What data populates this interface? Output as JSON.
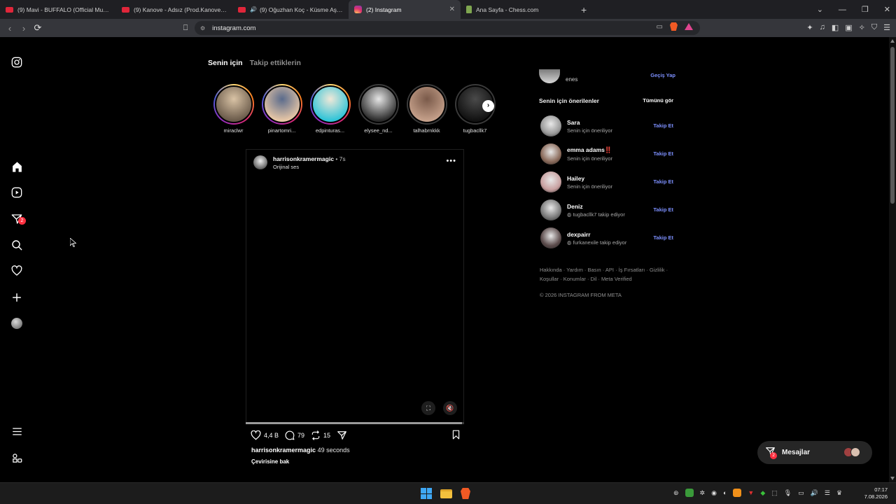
{
  "browser": {
    "tabs": [
      {
        "title": "(9) Mavi - BUFFALO (Official Music V",
        "favicon": "youtube-icon",
        "audio": false,
        "active": false
      },
      {
        "title": "(9) Kanove - Adsız (Prod.Kanove) - Yo",
        "favicon": "youtube-icon",
        "audio": false,
        "active": false
      },
      {
        "title": "(9) Oğuzhan Koç - Küsme Aşka -",
        "favicon": "youtube-icon",
        "audio": true,
        "active": false
      },
      {
        "title": "(2) Instagram",
        "favicon": "instagram-icon",
        "audio": false,
        "active": true
      },
      {
        "title": "Ana Sayfa - Chess.com",
        "favicon": "chess-icon",
        "audio": false,
        "active": false
      }
    ],
    "url": "instagram.com",
    "accent": "#f15a24"
  },
  "leftnav": {
    "items": [
      "instagram-logo",
      "home",
      "reels",
      "messages",
      "search",
      "notifications",
      "create",
      "profile",
      "more",
      "also-from-meta"
    ],
    "messages_badge": "2"
  },
  "feed": {
    "tab_for_you": "Senin için",
    "tab_following": "Takip ettiklerin",
    "stories": [
      {
        "name": "miraclwr",
        "seen": false,
        "colors": [
          "#6a5a4a",
          "#d9c3a5"
        ]
      },
      {
        "name": "pinartomri...",
        "seen": false,
        "colors": [
          "#e8c7a6",
          "#5a6b8c"
        ]
      },
      {
        "name": "edpinturas...",
        "seen": false,
        "colors": [
          "#2fc4d8",
          "#f0e8d8"
        ]
      },
      {
        "name": "elysee_nd...",
        "seen": true,
        "colors": [
          "#2a2a2a",
          "#e6e6e6"
        ]
      },
      {
        "name": "talhabrnkkk",
        "seen": true,
        "colors": [
          "#c5a08a",
          "#7a5a4a"
        ]
      },
      {
        "name": "tugbacllk7",
        "seen": true,
        "colors": [
          "#111",
          "#4a4a4a"
        ]
      }
    ],
    "post": {
      "username": "harrisonkramermagic",
      "time": "7s",
      "audio": "Orijinal ses",
      "likes": "4,4 B",
      "comments": "79",
      "reposts": "15",
      "caption_user": "harrisonkramermagic",
      "caption_text": "49 seconds",
      "translate": "Çevirisine bak",
      "progress": 0.99
    }
  },
  "sidebar": {
    "me_name": "enes",
    "switch": "Geçiş Yap",
    "suggestions_title": "Senin için önerilenler",
    "see_all": "Tümünü gör",
    "suggestions": [
      {
        "name": "Sara",
        "sub": "Senin için öneriliyor",
        "follow": "Takip Et",
        "has_mutual_icon": false,
        "color": "#9a9a9a"
      },
      {
        "name": "emma adams‼️",
        "sub": "Senin için öneriliyor",
        "follow": "Takip Et",
        "has_mutual_icon": false,
        "color": "#8a6a5a"
      },
      {
        "name": "Hailey",
        "sub": "Senin için öneriliyor",
        "follow": "Takip Et",
        "has_mutual_icon": false,
        "color": "#c8a0a0"
      },
      {
        "name": "Deniz",
        "sub": "tugbacllk7 takip ediyor",
        "follow": "Takip Et",
        "has_mutual_icon": true,
        "color": "#7a7a7a"
      },
      {
        "name": "dexpairr",
        "sub": "furkanexile takip ediyor",
        "follow": "Takip Et",
        "has_mutual_icon": true,
        "color": "#5a4a4a"
      }
    ],
    "footer_links": "Hakkında · Yardım · Basın · API · İş Fırsatları · Gizlilik · Koşullar · Konumlar · Dil · Meta Verified",
    "copyright": "© 2026 INSTAGRAM FROM META"
  },
  "messages_button": {
    "label": "Mesajlar",
    "badge": "2"
  },
  "taskbar": {
    "time": "07:17",
    "date": "7.08.2026"
  }
}
